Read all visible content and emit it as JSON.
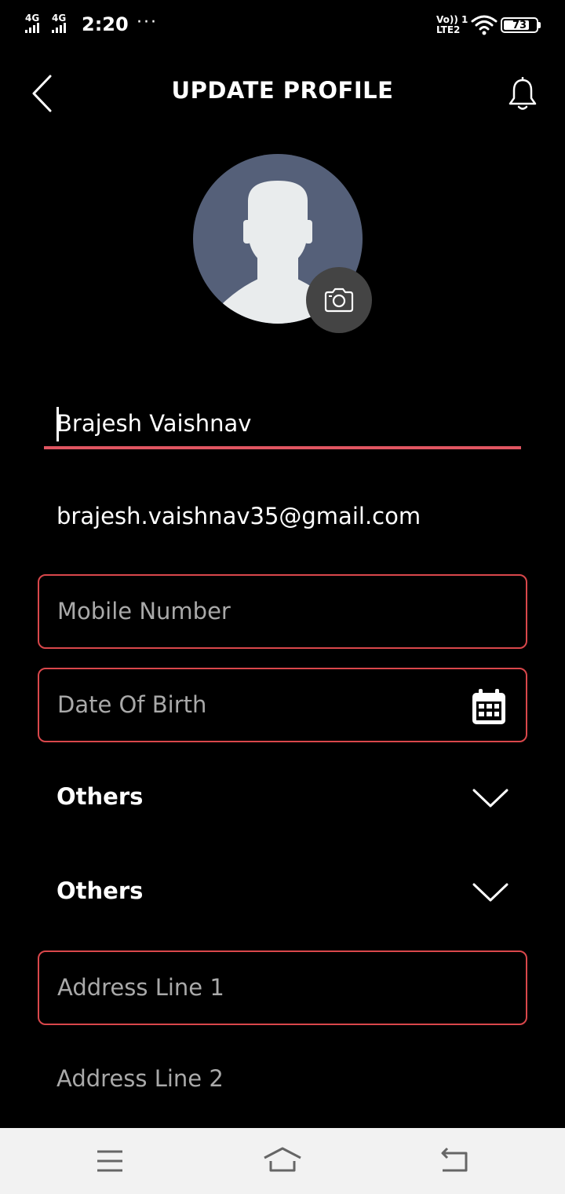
{
  "status_bar": {
    "network_1": "4G",
    "network_2": "4G",
    "time": "2:20",
    "more": "···",
    "volte_top": "Vo)) 1",
    "volte_bottom": "LTE2",
    "battery": "73"
  },
  "header": {
    "title": "UPDATE PROFILE",
    "back_icon": "back-arrow-icon",
    "notification_icon": "bell-icon"
  },
  "avatar": {
    "icon": "default-user-silhouette",
    "camera_icon": "camera-icon"
  },
  "form": {
    "name_value": "Brajesh Vaishnav",
    "email_value": "brajesh.vaishnav35@gmail.com",
    "mobile_placeholder": "Mobile Number",
    "dob_placeholder": "Date Of Birth",
    "select_1_value": "Others",
    "select_2_value": "Others",
    "address1_placeholder": "Address Line 1",
    "address2_placeholder": "Address Line 2"
  },
  "colors": {
    "background": "#000000",
    "accent_underline": "#e05561",
    "field_border": "#d9474b",
    "avatar_bg": "#556079",
    "placeholder": "#a9a9a9"
  },
  "nav_bar": {
    "menu_icon": "menu-icon",
    "home_icon": "home-icon",
    "back_icon": "return-icon"
  }
}
